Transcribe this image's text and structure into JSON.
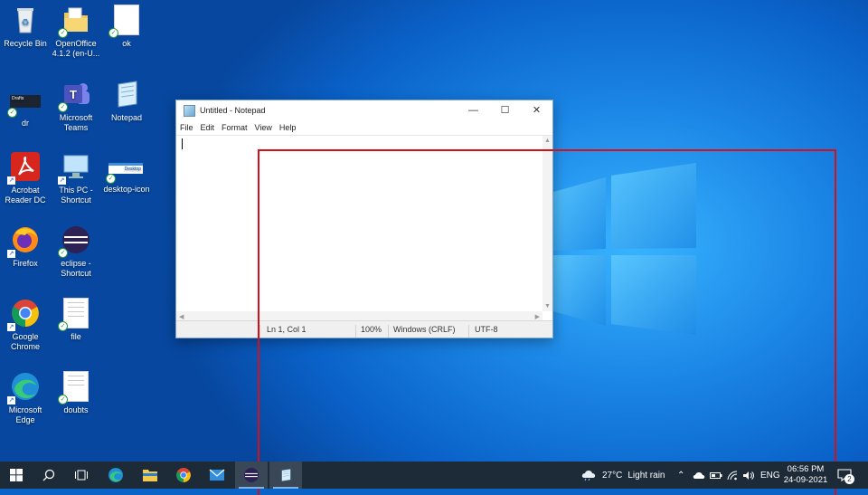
{
  "desktop": {
    "icons": [
      {
        "label": "Recycle Bin"
      },
      {
        "label": "OpenOffice 4.1.2 (en-U..."
      },
      {
        "label": "ok"
      },
      {
        "label": "dr",
        "thumb_text": "Drafts"
      },
      {
        "label": "Microsoft Teams"
      },
      {
        "label": "Notepad"
      },
      {
        "label": "Acrobat Reader DC"
      },
      {
        "label": "This PC - Shortcut"
      },
      {
        "label": "desktop-icon",
        "thumb_text": "Desktop"
      },
      {
        "label": "Firefox"
      },
      {
        "label": "eclipse - Shortcut"
      },
      {
        "label": "Google Chrome"
      },
      {
        "label": "file"
      },
      {
        "label": "Microsoft Edge"
      },
      {
        "label": "doubts"
      }
    ]
  },
  "notepad": {
    "title": "Untitled - Notepad",
    "menu": [
      "File",
      "Edit",
      "Format",
      "View",
      "Help"
    ],
    "content": "",
    "status": {
      "position": "Ln 1, Col 1",
      "zoom": "100%",
      "line_ending": "Windows (CRLF)",
      "encoding": "UTF-8"
    }
  },
  "taskbar": {
    "weather_temp": "27°C",
    "weather_desc": "Light rain",
    "language": "ENG",
    "time": "06:56 PM",
    "date": "24-09-2021",
    "notification_count": "2",
    "apps": [
      "start",
      "search",
      "task-view",
      "edge",
      "file-explorer",
      "chrome",
      "mail",
      "eclipse",
      "notepad"
    ]
  },
  "colors": {
    "annotation_box": "#d4111a",
    "taskbar": "#1d2a38"
  }
}
